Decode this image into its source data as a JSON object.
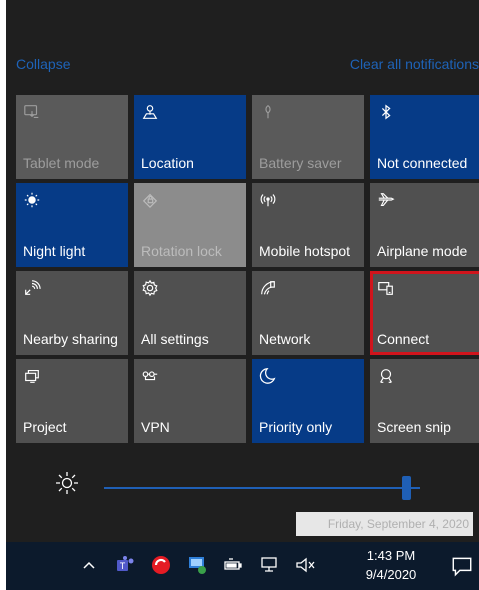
{
  "header": {
    "collapse_label": "Collapse",
    "clear_label": "Clear all notifications"
  },
  "tiles": [
    {
      "label": "Tablet mode",
      "icon": "tablet-mode-icon",
      "state": "disabled"
    },
    {
      "label": "Location",
      "icon": "location-icon",
      "state": "on"
    },
    {
      "label": "Battery saver",
      "icon": "battery-saver-icon",
      "state": "disabled"
    },
    {
      "label": "Not connected",
      "icon": "bluetooth-icon",
      "state": "on"
    },
    {
      "label": "Night light",
      "icon": "night-light-icon",
      "state": "on"
    },
    {
      "label": "Rotation lock",
      "icon": "rotation-lock-icon",
      "state": "light"
    },
    {
      "label": "Mobile hotspot",
      "icon": "mobile-hotspot-icon",
      "state": "off"
    },
    {
      "label": "Airplane mode",
      "icon": "airplane-icon",
      "state": "off"
    },
    {
      "label": "Nearby sharing",
      "icon": "nearby-sharing-icon",
      "state": "off"
    },
    {
      "label": "All settings",
      "icon": "gear-icon",
      "state": "off"
    },
    {
      "label": "Network",
      "icon": "network-icon",
      "state": "off"
    },
    {
      "label": "Connect",
      "icon": "connect-icon",
      "state": "off",
      "focused": true
    },
    {
      "label": "Project",
      "icon": "project-icon",
      "state": "off"
    },
    {
      "label": "VPN",
      "icon": "vpn-icon",
      "state": "off"
    },
    {
      "label": "Priority only",
      "icon": "moon-icon",
      "state": "on"
    },
    {
      "label": "Screen snip",
      "icon": "screen-snip-icon",
      "state": "off"
    }
  ],
  "brightness": {
    "level_fraction": 0.97
  },
  "tooltip": {
    "text": "Friday, September 4, 2020"
  },
  "taskbar": {
    "time": "1:43 PM",
    "date": "9/4/2020",
    "icons": [
      "chevron-up-icon",
      "teams-icon",
      "antivirus-icon",
      "security-icon",
      "battery-icon",
      "network-icon",
      "volume-mute-icon",
      "notification-icon"
    ]
  },
  "colors": {
    "accent": "#063b87",
    "tile": "#505050",
    "focus": "#d0141c",
    "link": "#1e63b8"
  }
}
